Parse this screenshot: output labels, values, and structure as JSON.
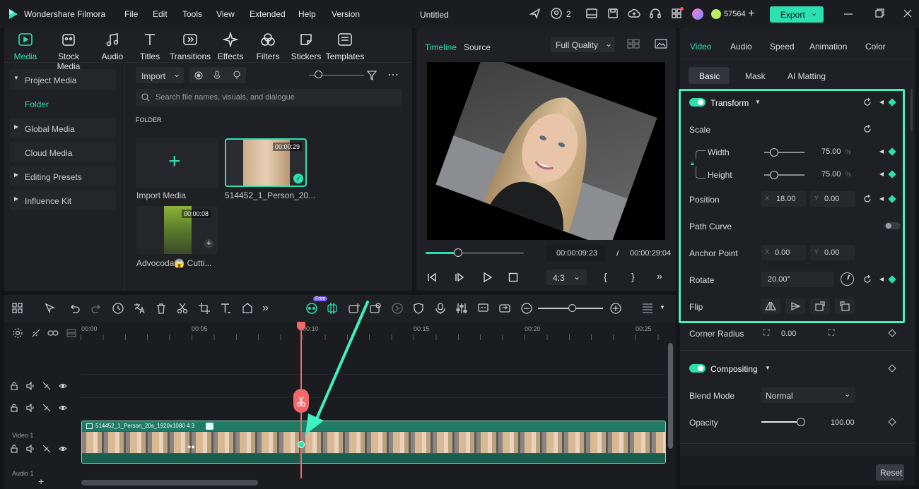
{
  "app": {
    "name": "Wondershare Filmora",
    "project_title": "Untitled",
    "credits": "57564",
    "collab_count": "2",
    "export_label": "Export",
    "menu": [
      "File",
      "Edit",
      "Tools",
      "View",
      "Extended",
      "Help",
      "Version"
    ]
  },
  "toolbar": {
    "items": [
      "Media",
      "Stock Media",
      "Audio",
      "Titles",
      "Transitions",
      "Effects",
      "Filters",
      "Stickers",
      "Templates"
    ]
  },
  "media_sidebar": {
    "items": [
      "Project Media",
      "Folder",
      "Global Media",
      "Cloud Media",
      "Editing Presets",
      "Influence Kit"
    ]
  },
  "media": {
    "import_label": "Import",
    "search_placeholder": "Search file names, visuals, and dialogue",
    "folder_heading": "FOLDER",
    "import_tile_label": "Import Media",
    "clips": [
      {
        "name": "514452_1_Person_20...",
        "duration": "00:00:29"
      },
      {
        "name": "Advocoda😱 Cutti...",
        "duration": "00:00:08"
      }
    ]
  },
  "player": {
    "tabs": [
      "Timeline",
      "Source"
    ],
    "quality": "Full Quality",
    "current_time": "00:00:09:23",
    "total_time": "00:00:29:04",
    "separator": "/",
    "aspect": "4:3",
    "progress": 0.33
  },
  "timeline": {
    "ruler": [
      "00:00",
      "00:05",
      "00:10",
      "00:15",
      "00:20",
      "00:25"
    ],
    "track_video_label": "Video 1",
    "track_audio_label": "Audio 1",
    "clip_title": "514452_1_Person_20s_1920x1080 4 3",
    "free_badge": "Free"
  },
  "properties": {
    "tabs": [
      "Video",
      "Audio",
      "Speed",
      "Animation",
      "Color"
    ],
    "subtabs": [
      "Basic",
      "Mask",
      "AI Matting"
    ],
    "transform": {
      "title": "Transform",
      "scale_label": "Scale",
      "width_label": "Width",
      "width_value": "75.00",
      "width_unit": "%",
      "height_label": "Height",
      "height_value": "75.00",
      "height_unit": "%",
      "position_label": "Position",
      "pos_x_axis": "X",
      "pos_x": "18.00",
      "pos_y_axis": "Y",
      "pos_y": "0.00",
      "path_curve_label": "Path Curve",
      "anchor_label": "Anchor Point",
      "anchor_x_axis": "X",
      "anchor_x": "0.00",
      "anchor_y_axis": "Y",
      "anchor_y": "0.00",
      "rotate_label": "Rotate",
      "rotate_value": "20.00°",
      "flip_label": "Flip"
    },
    "corner_radius_label": "Corner Radius",
    "corner_radius_value": "0.00",
    "compositing": {
      "title": "Compositing",
      "blend_label": "Blend Mode",
      "blend_value": "Normal",
      "opacity_label": "Opacity",
      "opacity_value": "100.00"
    },
    "reset_label": "Reset"
  },
  "colors": {
    "accent": "#1ee6b4",
    "highlight_border": "#3ff0c0",
    "playhead": "#f2686a",
    "clip": "#1f7a66"
  }
}
